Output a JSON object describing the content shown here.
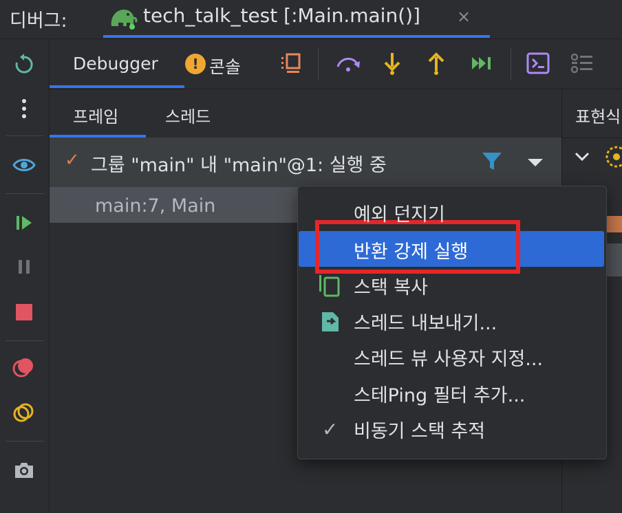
{
  "titlebar": {
    "label": "디버그:",
    "run_tab": "tech_talk_test [:Main.main()]",
    "close_glyph": "×",
    "run_icon": "gradle-elephant-icon"
  },
  "left_toolbar": {
    "items": [
      "rerun-icon",
      "more-options-icon",
      "view-breakpoints-icon",
      "resume-icon",
      "pause-icon",
      "stop-icon",
      "mute-breakpoints-icon",
      "get-thread-dump-icon",
      "camera-icon"
    ]
  },
  "debug_toolbar": {
    "tab_debugger": "Debugger",
    "tab_console": "콘솔",
    "warning_badge": "!",
    "icons": [
      "frames-layout-icon",
      "step-over-icon",
      "step-into-icon",
      "step-out-icon",
      "run-to-cursor-icon",
      "evaluate-expression-icon",
      "threads-view-icon"
    ]
  },
  "frames_panel": {
    "tab_frames": "프레임",
    "tab_threads": "스레드",
    "thread_check": "✓",
    "thread_label": "그룹 \"main\" 내 \"main\"@1: 실행 중",
    "frame_label": "main:7, Main"
  },
  "vars_panel": {
    "header": "표현식"
  },
  "context_menu": {
    "items": [
      "예외 던지기",
      "반환 강제 실행",
      "스택 복사",
      "스레드 내보내기...",
      "스레드 뷰 사용자 지정...",
      "스테Ping 필터 추가...",
      "비동기 스택 추적"
    ],
    "selected_index": 1,
    "check_glyph": "✓"
  },
  "colors": {
    "accent": "#3574f0",
    "selection": "#2e6ad6",
    "highlight_border": "#e5262a",
    "step_icons": "#e6b422",
    "stop": "#e05561",
    "resume": "#5fb865"
  }
}
